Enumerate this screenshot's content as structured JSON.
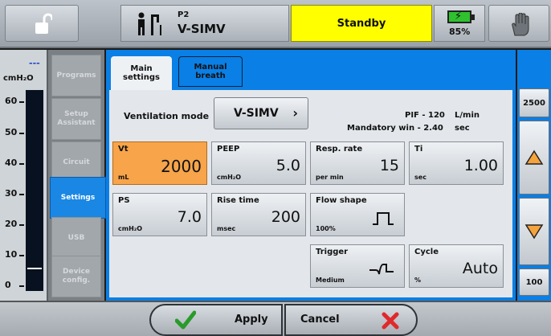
{
  "header": {
    "patient_label": "P2",
    "mode": "V-SIMV",
    "status": "Standby",
    "battery": "85%"
  },
  "pressure": {
    "indicator": "---",
    "unit": "cmH₂O",
    "ticks": [
      "60",
      "50",
      "40",
      "30",
      "20",
      "10",
      "0"
    ]
  },
  "nav": {
    "items": [
      {
        "label": "Programs"
      },
      {
        "label": "Setup Assistant"
      },
      {
        "label": "Circuit"
      },
      {
        "label": "Settings"
      },
      {
        "label": "USB"
      },
      {
        "label": "Device config."
      }
    ]
  },
  "tabs": [
    {
      "label": "Main settings"
    },
    {
      "label": "Manual breath"
    }
  ],
  "ventilation": {
    "label": "Ventilation mode",
    "value": "V-SIMV",
    "pif": "PIF - 120",
    "pif_unit": "L/min",
    "mandatory": "Mandatory win - 2.40",
    "mandatory_unit": "sec"
  },
  "params": {
    "vt": {
      "name": "Vt",
      "value": "2000",
      "unit": "mL"
    },
    "peep": {
      "name": "PEEP",
      "value": "5.0",
      "unit": "cmH₂O"
    },
    "resp_rate": {
      "name": "Resp. rate",
      "value": "15",
      "unit": "per min"
    },
    "ti": {
      "name": "Ti",
      "value": "1.00",
      "unit": "sec"
    },
    "ps": {
      "name": "PS",
      "value": "7.0",
      "unit": "cmH₂O"
    },
    "rise_time": {
      "name": "Rise time",
      "value": "200",
      "unit": "msec"
    },
    "flow_shape": {
      "name": "Flow shape",
      "unit": "100%"
    },
    "trigger": {
      "name": "Trigger",
      "unit": "Medium"
    },
    "cycle": {
      "name": "Cycle",
      "value": "Auto",
      "unit": "%"
    }
  },
  "adjust": {
    "max": "2500",
    "min": "100"
  },
  "footer": {
    "apply": "Apply",
    "cancel": "Cancel"
  },
  "colors": {
    "accent_blue": "#0a7fe5",
    "standby_yellow": "#ffff00",
    "highlight_orange": "#f7a44a"
  }
}
